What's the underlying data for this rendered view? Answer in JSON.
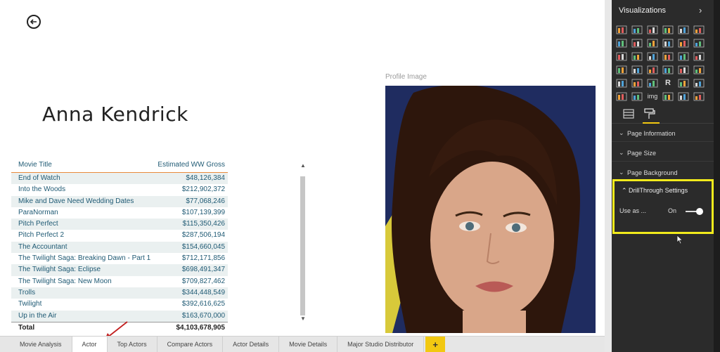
{
  "report": {
    "actor_name": "Anna Kendrick",
    "profile_label": "Profile Image"
  },
  "table": {
    "col_title": "Movie Title",
    "col_gross": "Estimated WW Gross",
    "rows": [
      {
        "title": "End of Watch",
        "gross": "$48,126,384"
      },
      {
        "title": "Into the Woods",
        "gross": "$212,902,372"
      },
      {
        "title": "Mike and Dave Need Wedding Dates",
        "gross": "$77,068,246"
      },
      {
        "title": "ParaNorman",
        "gross": "$107,139,399"
      },
      {
        "title": "Pitch Perfect",
        "gross": "$115,350,426"
      },
      {
        "title": "Pitch Perfect 2",
        "gross": "$287,506,194"
      },
      {
        "title": "The Accountant",
        "gross": "$154,660,045"
      },
      {
        "title": "The Twilight Saga: Breaking Dawn - Part 1",
        "gross": "$712,171,856"
      },
      {
        "title": "The Twilight Saga: Eclipse",
        "gross": "$698,491,347"
      },
      {
        "title": "The Twilight Saga: New Moon",
        "gross": "$709,827,462"
      },
      {
        "title": "Trolls",
        "gross": "$344,448,549"
      },
      {
        "title": "Twilight",
        "gross": "$392,616,625"
      },
      {
        "title": "Up in the Air",
        "gross": "$163,670,000"
      }
    ],
    "total_label": "Total",
    "total_value": "$4,103,678,905"
  },
  "tabs": [
    {
      "label": "Movie Analysis",
      "active": false
    },
    {
      "label": "Actor",
      "active": true
    },
    {
      "label": "Top Actors",
      "active": false
    },
    {
      "label": "Compare Actors",
      "active": false
    },
    {
      "label": "Actor Details",
      "active": false
    },
    {
      "label": "Movie Details",
      "active": false
    },
    {
      "label": "Major Studio Distributor",
      "active": false
    }
  ],
  "tab_add": "+",
  "panel": {
    "title": "Visualizations",
    "sections": {
      "page_information": "Page Information",
      "page_size": "Page Size",
      "page_background": "Page Background",
      "drillthrough": "DrillThrough Settings"
    },
    "use_as_label": "Use as ...",
    "toggle_state": "On",
    "r_visual": "R",
    "img_visual": "img"
  },
  "colors": {
    "accent": "#f2c811",
    "highlight_box": "#f1ea1c",
    "table_text": "#1f5a74",
    "header_rule": "#e88a3c"
  }
}
